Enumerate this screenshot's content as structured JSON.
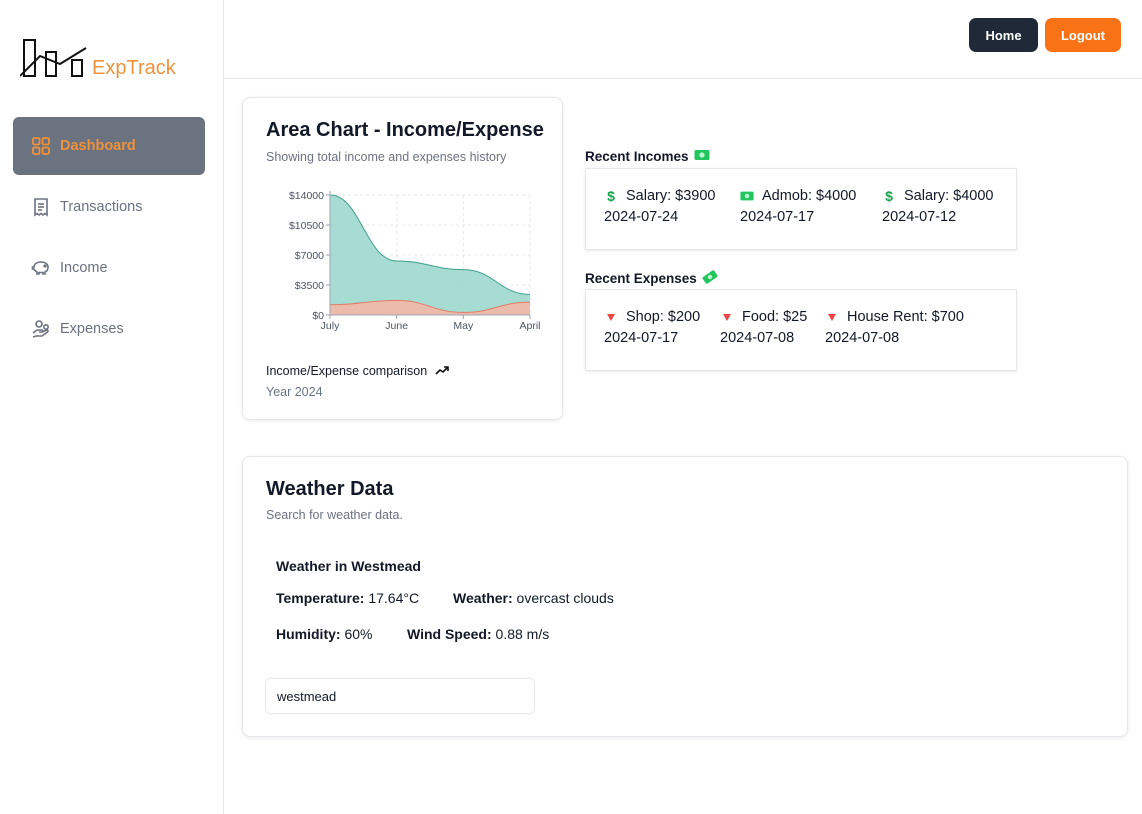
{
  "brand": {
    "name": "ExpTrack",
    "color": "#f0923a"
  },
  "sidebar": {
    "items": [
      {
        "label": "Dashboard",
        "icon": "grid-icon",
        "active": true
      },
      {
        "label": "Transactions",
        "icon": "receipt-icon",
        "active": false
      },
      {
        "label": "Income",
        "icon": "piggy-bank-icon",
        "active": false
      },
      {
        "label": "Expenses",
        "icon": "hand-coins-icon",
        "active": false
      }
    ]
  },
  "header": {
    "home_label": "Home",
    "logout_label": "Logout"
  },
  "chart_card": {
    "title": "Area Chart - Income/Expense",
    "subtitle": "Showing total income and expenses history",
    "footer": "Income/Expense comparison",
    "footer_icon": "trending-up-icon",
    "year": "Year 2024"
  },
  "chart_data": {
    "type": "area",
    "categories": [
      "July",
      "June",
      "May",
      "April"
    ],
    "ytick_labels": [
      "$0",
      "$3500",
      "$7000",
      "$10500",
      "$14000"
    ],
    "yticks": [
      0,
      3500,
      7000,
      10500,
      14000
    ],
    "ylim": [
      0,
      14000
    ],
    "grid": true,
    "series": [
      {
        "values": [
          1200,
          1700,
          300,
          1500
        ],
        "color": "#f3b8a7",
        "stroke": "#e07a65"
      },
      {
        "values": [
          14000,
          6300,
          5300,
          2400
        ],
        "color": "#9dd8ce",
        "stroke": "#3f9e8c"
      }
    ]
  },
  "recent_incomes": {
    "label": "Recent Incomes",
    "emoji": "dollar-banknote-icon",
    "items": [
      {
        "text": "Salary: $3900",
        "date": "2024-07-24",
        "icon": "dollar-sign-icon"
      },
      {
        "text": "Admob: $4000",
        "date": "2024-07-17",
        "icon": "dollar-banknote-icon"
      },
      {
        "text": "Salary: $4000",
        "date": "2024-07-12",
        "icon": "dollar-sign-icon"
      }
    ]
  },
  "recent_expenses": {
    "label": "Recent Expenses",
    "emoji": "money-with-wings-icon",
    "items": [
      {
        "text": "Shop: $200",
        "date": "2024-07-17",
        "icon": "red-triangle-down-icon"
      },
      {
        "text": "Food: $25",
        "date": "2024-07-08",
        "icon": "red-triangle-down-icon"
      },
      {
        "text": "House Rent: $700",
        "date": "2024-07-08",
        "icon": "red-triangle-down-icon"
      }
    ]
  },
  "weather": {
    "title": "Weather Data",
    "subtitle": "Search for weather data.",
    "location_heading": "Weather in Westmead",
    "temperature_label": "Temperature:",
    "temperature_value": "17.64°C",
    "weather_label": "Weather:",
    "weather_value": "overcast clouds",
    "humidity_label": "Humidity:",
    "humidity_value": "60%",
    "wind_label": "Wind Speed:",
    "wind_value": "0.88 m/s",
    "search_value": "westmead"
  }
}
